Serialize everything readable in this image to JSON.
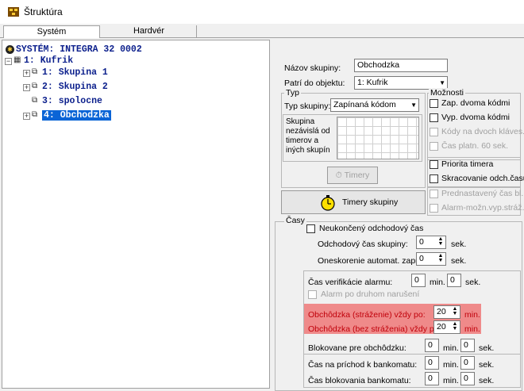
{
  "window": {
    "title": "Štruktúra"
  },
  "tabs": [
    {
      "label": "Systém",
      "active": true
    },
    {
      "label": "Hardvér",
      "active": false
    }
  ],
  "tree": {
    "root": "SYSTÉM: INTEGRA 32 0002",
    "object": "1: Kufrik",
    "groups": [
      "1: Skupina 1",
      "2: Skupina 2",
      "3: spolocne",
      "4: Obchodzka"
    ],
    "selected_index": 3
  },
  "form": {
    "group_name_label": "Názov skupiny:",
    "group_name_value": "Obchodzka",
    "belongs_label": "Patrí do objektu:",
    "belongs_value": "1: Kufrik",
    "type_legend": "Typ",
    "type_label": "Typ skupiny:",
    "type_value": "Zapínaná kódom",
    "independent_note": "Skupina nezávislá od timerov a iných skupín",
    "timers_button": "Timery",
    "group_timers_button": "Timery skupiny",
    "options_legend": "Možnosti",
    "options": [
      {
        "label": "Zap. dvoma kódmi",
        "enabled": true
      },
      {
        "label": "Vyp. dvoma kódmi",
        "enabled": true
      },
      {
        "label": "Kódy na dvoch kláves.",
        "enabled": false
      },
      {
        "label": "Čas platn. 60 sek.",
        "enabled": false
      },
      {
        "label": "Priorita timera",
        "enabled": true
      },
      {
        "label": "Skracovanie odch.času",
        "enabled": true
      },
      {
        "label": "Prednastavený čas bl.",
        "enabled": false
      },
      {
        "label": "Alarm-možn.vyp.stráž.",
        "enabled": false
      }
    ],
    "times_legend": "Časy",
    "infinite_exit": "Neukončený odchodový čas",
    "exit_time_label": "Odchodový čas skupiny:",
    "exit_time_value": "0",
    "exit_time_unit": "sek.",
    "delay_label": "Oneskorenie automat. zapn.",
    "delay_value": "0",
    "delay_unit": "sek.",
    "verif_label": "Čas verifikácie alarmu:",
    "verif_min": "0",
    "verif_sec": "0",
    "alarm_second": "Alarm po druhom narušení",
    "guard_armed_label": "Obchôdzka (stráženie) vždy po:",
    "guard_armed_value": "20",
    "guard_disarmed_label": "Obchôdzka (bez stráženia) vždy po:",
    "guard_disarmed_value": "20",
    "blocked_label": "Blokovane pre obchôdzku:",
    "blocked_min": "0",
    "blocked_sec": "0",
    "bank_arrival_label": "Čas na príchod k bankomatu:",
    "bank_arrival_min": "0",
    "bank_arrival_sec": "0",
    "bank_block_label": "Čas blokovania bankomatu:",
    "bank_block_min": "0",
    "bank_block_sec": "0",
    "unit_min": "min.",
    "unit_sec": "sek."
  }
}
